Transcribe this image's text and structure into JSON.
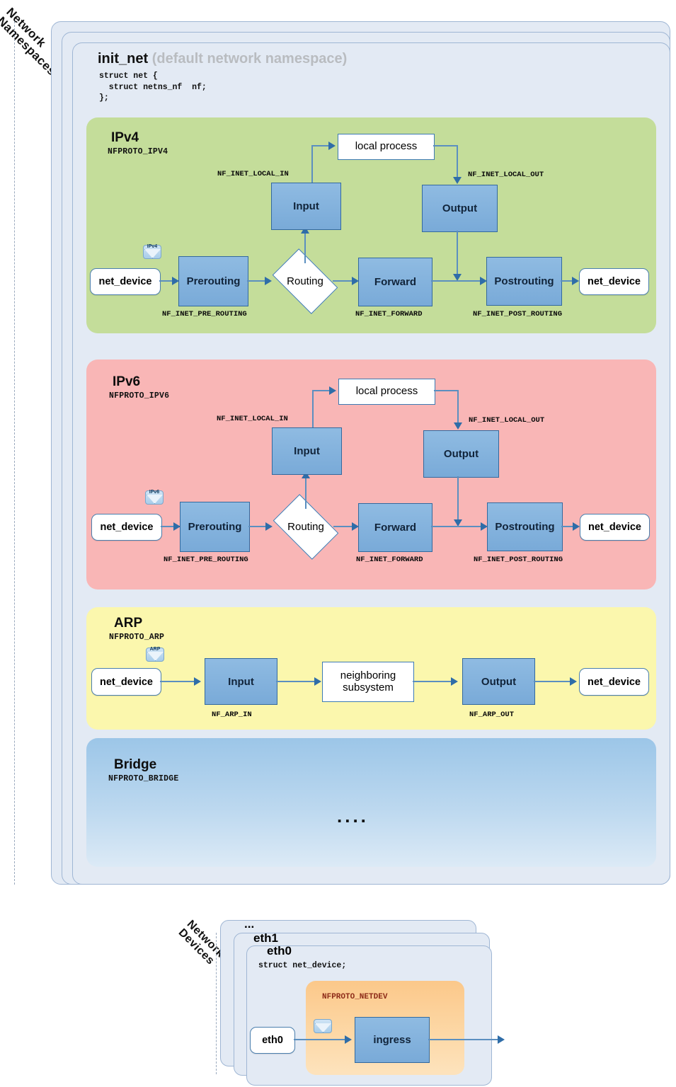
{
  "namespaces": {
    "stack_label": "Network\nNamespaces",
    "title": "init_net",
    "title_suffix": "(default network namespace)",
    "code": "struct net {\n  struct netns_nf  nf;\n};"
  },
  "families": [
    {
      "id": "ipv4",
      "title": "IPv4",
      "proto": "NFPROTO_IPV4",
      "color": "#c4dd9a",
      "packet_icon": "IPv4",
      "nodes": {
        "in_device": "net_device",
        "prerouting": "Prerouting",
        "routing": "Routing",
        "forward": "Forward",
        "postrouting": "Postrouting",
        "out_device": "net_device",
        "input": "Input",
        "output": "Output",
        "local_process": "local process"
      },
      "hooks": {
        "pre": "NF_INET_PRE_ROUTING",
        "local_in": "NF_INET_LOCAL_IN",
        "forward": "NF_INET_FORWARD",
        "local_out": "NF_INET_LOCAL_OUT",
        "post": "NF_INET_POST_ROUTING"
      }
    },
    {
      "id": "ipv6",
      "title": "IPv6",
      "proto": "NFPROTO_IPV6",
      "color": "#f9b6b6",
      "packet_icon": "IPv6",
      "nodes": {
        "in_device": "net_device",
        "prerouting": "Prerouting",
        "routing": "Routing",
        "forward": "Forward",
        "postrouting": "Postrouting",
        "out_device": "net_device",
        "input": "Input",
        "output": "Output",
        "local_process": "local process"
      },
      "hooks": {
        "pre": "NF_INET_PRE_ROUTING",
        "local_in": "NF_INET_LOCAL_IN",
        "forward": "NF_INET_FORWARD",
        "local_out": "NF_INET_LOCAL_OUT",
        "post": "NF_INET_POST_ROUTING"
      }
    }
  ],
  "arp": {
    "title": "ARP",
    "proto": "NFPROTO_ARP",
    "color": "#fbf7ad",
    "packet_icon": "ARP",
    "nodes": {
      "in_device": "net_device",
      "input": "Input",
      "neighboring": "neighboring\nsubsystem",
      "output": "Output",
      "out_device": "net_device"
    },
    "hooks": {
      "in": "NF_ARP_IN",
      "out": "NF_ARP_OUT"
    }
  },
  "bridge": {
    "title": "Bridge",
    "proto": "NFPROTO_BRIDGE",
    "ellipsis": "...."
  },
  "devices": {
    "stack_label": "Network\nDevices",
    "card_more": "...",
    "card_eth1": "eth1",
    "card_eth0": "eth0",
    "code": "struct net_device;",
    "netdev_proto": "NFPROTO_NETDEV",
    "device_pill": "eth0",
    "ingress": "ingress",
    "packet_icon": ""
  }
}
